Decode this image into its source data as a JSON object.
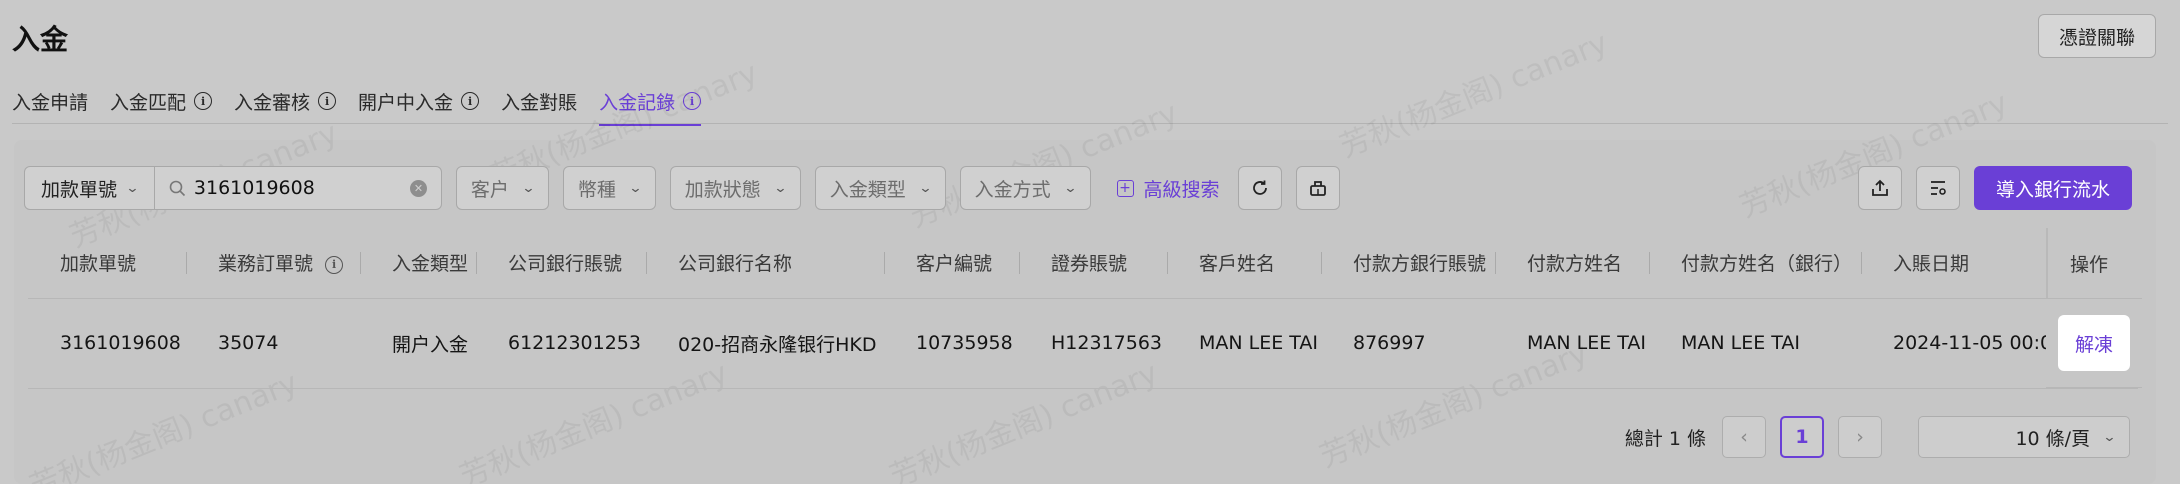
{
  "page": {
    "title": "入金",
    "top_button": "憑證關聯"
  },
  "tabs": [
    {
      "label": "入金申請",
      "info": false,
      "active": false
    },
    {
      "label": "入金匹配",
      "info": true,
      "active": false
    },
    {
      "label": "入金審核",
      "info": true,
      "active": false
    },
    {
      "label": "開户中入金",
      "info": true,
      "active": false
    },
    {
      "label": "入金對賬",
      "info": false,
      "active": false
    },
    {
      "label": "入金記錄",
      "info": true,
      "active": true
    }
  ],
  "toolbar": {
    "search_field_select": "加款單號",
    "search_value": "3161019608",
    "filters": [
      "客户",
      "幣種",
      "加款狀態",
      "入金類型",
      "入金方式"
    ],
    "advanced_search": "高級搜索",
    "import_button": "導入銀行流水"
  },
  "table": {
    "columns": [
      "加款單號",
      "業務訂單號",
      "入金類型",
      "公司銀行賬號",
      "公司銀行名称",
      "客户編號",
      "證券賬號",
      "客戶姓名",
      "付款方銀行賬號",
      "付款方姓名",
      "付款方姓名（銀行）",
      "入賬日期"
    ],
    "rows": [
      [
        "3161019608",
        "35074",
        "開户入金",
        "61212301253",
        "020-招商永隆银行HKD",
        "10735958",
        "H12317563",
        "MAN LEE TAI",
        "876997",
        "MAN LEE TAI",
        "MAN LEE TAI",
        "2024-11-05 00:0"
      ]
    ],
    "operation_header": "操作",
    "operation_action": "解凍"
  },
  "pagination": {
    "total_text": "總計 1 條",
    "current_page": "1",
    "page_size": "10 條/頁"
  },
  "watermark": "芳秋(杨金阁) canary",
  "colors": {
    "accent": "#6a3fd6",
    "background": "#c9c9c9"
  }
}
